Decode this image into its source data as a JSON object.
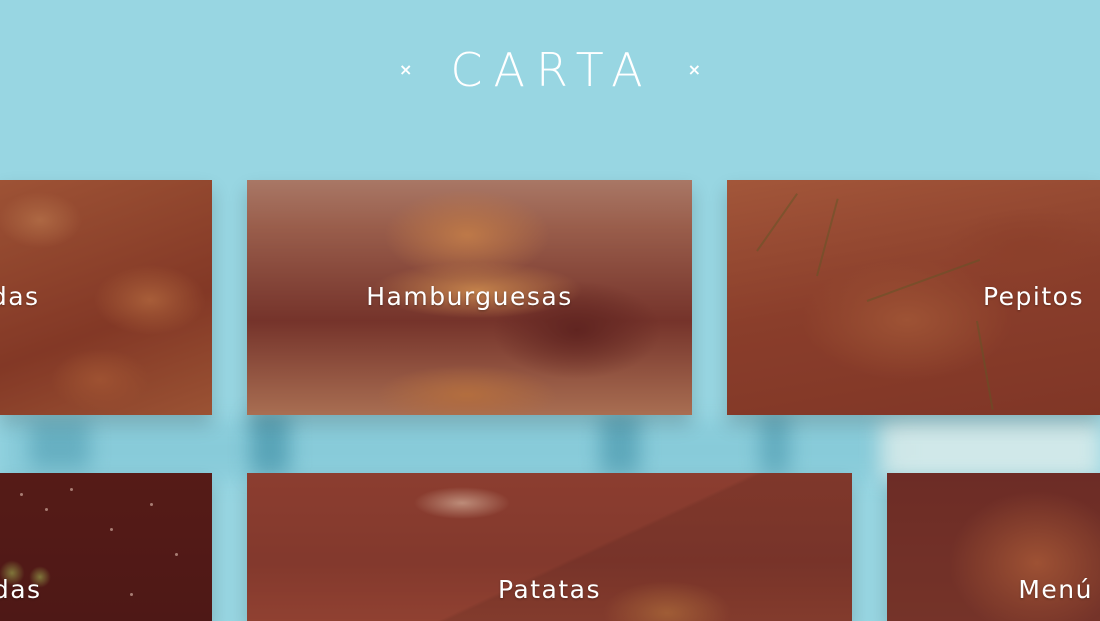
{
  "header": {
    "title": "CARTA",
    "left_decoration": "×",
    "right_decoration": "×"
  },
  "categories": [
    {
      "label": "adas"
    },
    {
      "label": "Hamburguesas"
    },
    {
      "label": "Pepitos"
    },
    {
      "label": "adas"
    },
    {
      "label": "Patatas"
    },
    {
      "label": "Menú"
    }
  ],
  "colors": {
    "background": "#98d6e2",
    "overlay": "#6e2823",
    "text": "#ffffff"
  }
}
